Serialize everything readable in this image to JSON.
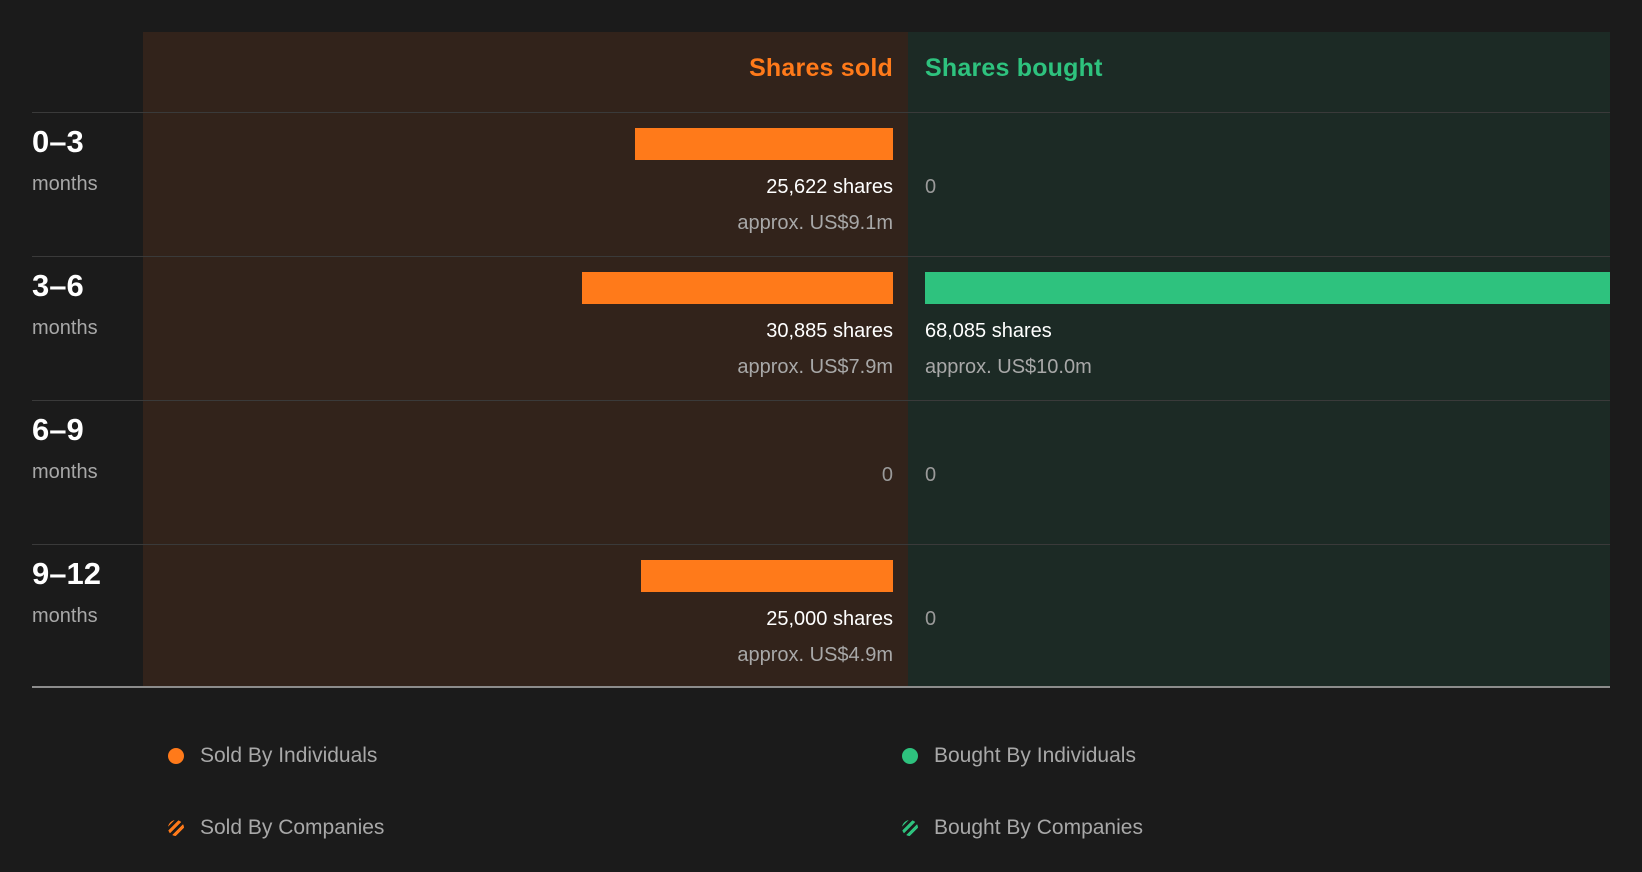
{
  "chart_data": {
    "type": "bar",
    "headers": {
      "sold": "Shares sold",
      "bought": "Shares bought"
    },
    "categories": [
      {
        "range": "0–3",
        "unit": "months"
      },
      {
        "range": "3–6",
        "unit": "months"
      },
      {
        "range": "6–9",
        "unit": "months"
      },
      {
        "range": "9–12",
        "unit": "months"
      }
    ],
    "series": [
      {
        "name": "Shares sold",
        "values": [
          25622,
          30885,
          0,
          25000
        ],
        "labels": [
          "25,622 shares",
          "30,885 shares",
          "0",
          "25,000 shares"
        ],
        "approx": [
          "approx. US$9.1m",
          "approx. US$7.9m",
          "",
          "approx. US$4.9m"
        ]
      },
      {
        "name": "Shares bought",
        "values": [
          0,
          68085,
          0,
          0
        ],
        "labels": [
          "0",
          "68,085 shares",
          "0",
          "0"
        ],
        "approx": [
          "",
          "approx. US$10.0m",
          "",
          ""
        ]
      }
    ],
    "legend": [
      {
        "label": "Sold By Individuals",
        "style": "solid",
        "color": "#ff7a1a"
      },
      {
        "label": "Bought By Individuals",
        "style": "solid",
        "color": "#2ec27e"
      },
      {
        "label": "Sold By Companies",
        "style": "hatched",
        "color": "#ff7a1a"
      },
      {
        "label": "Bought By Companies",
        "style": "hatched",
        "color": "#2ec27e"
      }
    ],
    "colors": {
      "sold": "#ff7a1a",
      "bought": "#2ec27e"
    }
  }
}
